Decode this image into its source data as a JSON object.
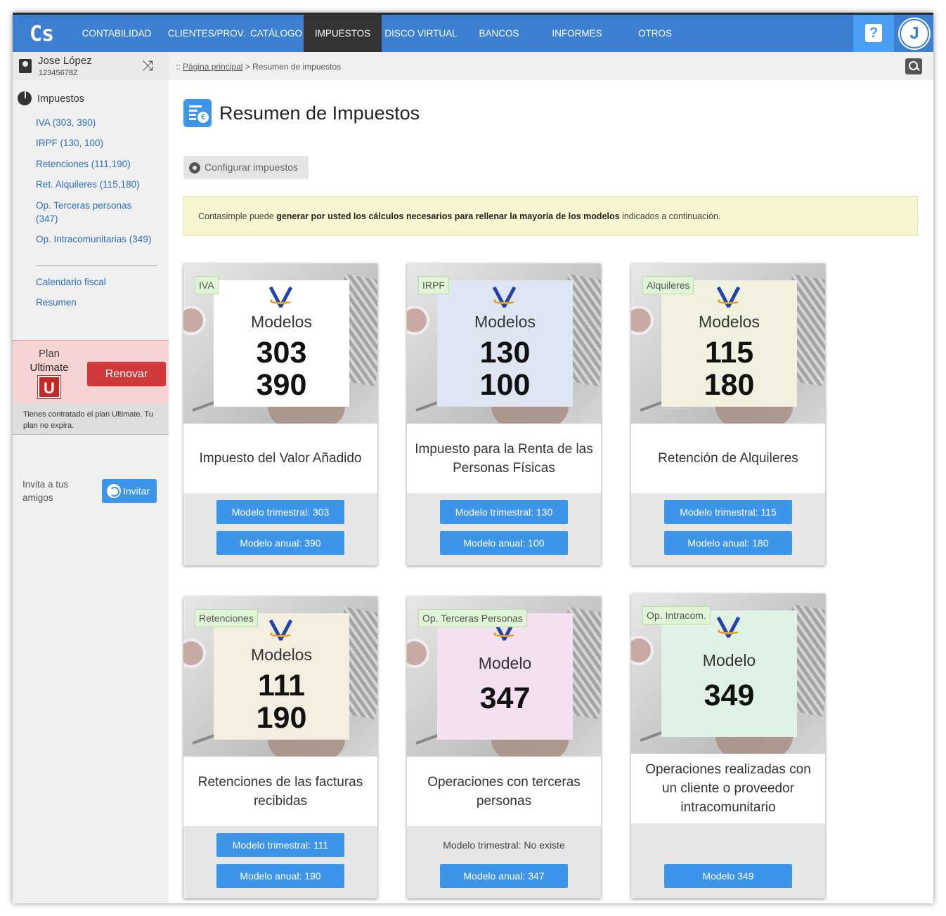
{
  "app": {
    "logo": "Cs"
  },
  "nav": {
    "items": [
      {
        "label": "CONTABILIDAD"
      },
      {
        "label": "CLIENTES/PROV."
      },
      {
        "label": "CATÁLOGO"
      },
      {
        "label": "IMPUESTOS"
      },
      {
        "label": "DISCO VIRTUAL"
      },
      {
        "label": "BANCOS"
      },
      {
        "label": "INFORMES"
      },
      {
        "label": "OTROS"
      }
    ],
    "active": "IMPUESTOS",
    "help_label": "?",
    "avatar_letter": "J"
  },
  "user": {
    "name": "Jose López",
    "id": "12345678Z"
  },
  "breadcrumb": {
    "prefix": "::",
    "home": "Página principal",
    "sep": ">",
    "current": "Resumen de impuestos"
  },
  "sidebar": {
    "title": "Impuestos",
    "items": [
      {
        "label": "IVA (303, 390)"
      },
      {
        "label": "IRPF (130, 100)"
      },
      {
        "label": "Retenciones (111,190)"
      },
      {
        "label": "Ret. Alquileres (115,180)"
      },
      {
        "label": "Op. Terceras personas (347)"
      },
      {
        "label": "Op. Intracomunitarias (349)"
      },
      {
        "label": "Calendario fiscal"
      },
      {
        "label": "Resumen"
      }
    ],
    "plan": {
      "label": "Plan",
      "name": "Ultimate",
      "badge": "U",
      "renew": "Renovar",
      "note": "Tienes contratado el plan Ultimate. Tu plan no expira."
    },
    "invite": {
      "text": "Invita a tus amigos",
      "button": "Invitar"
    }
  },
  "main": {
    "title": "Resumen de Impuestos",
    "config_button": "Configurar impuestos",
    "info": {
      "pre": "Contasimple puede ",
      "bold": "generar por usted los cálculos necesarios para rellenar la mayoría de los modelos",
      "post": " indicados a continuación."
    }
  },
  "cards": [
    {
      "tag": "IVA",
      "word": "Modelos",
      "num1": "303",
      "num2": "390",
      "desc": "Impuesto del Valor Añadido",
      "btn1": "Modelo trimestral: 303",
      "btn2": "Modelo anual: 390",
      "note_color": "#ffffff"
    },
    {
      "tag": "IRPF",
      "word": "Modelos",
      "num1": "130",
      "num2": "100",
      "desc": "Impuesto para la Renta de las Personas Físicas",
      "btn1": "Modelo trimestral: 130",
      "btn2": "Modelo anual: 100",
      "note_color": "#dfe6f3"
    },
    {
      "tag": "Alquileres",
      "word": "Modelos",
      "num1": "115",
      "num2": "180",
      "desc": "Retención de Alquileres",
      "btn1": "Modelo trimestral: 115",
      "btn2": "Modelo anual: 180",
      "note_color": "#f1f1df"
    },
    {
      "tag": "Retenciones",
      "word": "Modelos",
      "num1": "111",
      "num2": "190",
      "desc": "Retenciones de las facturas recibidas",
      "btn1": "Modelo trimestral: 111",
      "btn2": "Modelo anual: 190",
      "note_color": "#f3eedf"
    },
    {
      "tag": "Op. Terceras Personas",
      "word": "Modelo",
      "num1": "347",
      "desc": "Operaciones con terceras personas",
      "text1": "Modelo trimestral: No existe",
      "btn2": "Modelo anual: 347",
      "note_color": "#f3e0f0"
    },
    {
      "tag": "Op. Intracom.",
      "word": "Modelo",
      "num1": "349",
      "desc": "Operaciones realizadas con un cliente o proveedor intracomunitario",
      "btn2": "Modelo 349",
      "note_color": "#dff2e4"
    }
  ]
}
